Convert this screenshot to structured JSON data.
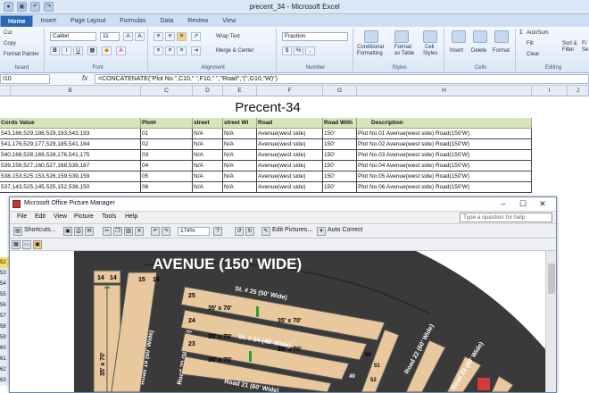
{
  "window": {
    "title": "precent_34 - Microsoft Excel"
  },
  "ribbon_tabs": [
    "Home",
    "Insert",
    "Page Layout",
    "Formulas",
    "Data",
    "Review",
    "View"
  ],
  "ribbon": {
    "clipboard": {
      "cut": "Cut",
      "copy": "Copy",
      "format_painter": "Format Painter",
      "label": "board"
    },
    "font": {
      "name": "Calibri",
      "size": "11",
      "label": "Font",
      "bold": "B",
      "italic": "I",
      "underline": "U"
    },
    "alignment": {
      "wrap": "Wrap Text",
      "merge": "Merge & Center",
      "label": "Alignment"
    },
    "number": {
      "format": "Fraction",
      "label": "Number",
      "currency": "$",
      "percent": "%",
      "comma": ","
    },
    "styles": {
      "cond": "Conditional",
      "cond2": "Formatting",
      "fmt": "Format",
      "fmt2": "as Table",
      "cell": "Cell",
      "cell2": "Styles",
      "label": "Styles"
    },
    "cells": {
      "insert": "Insert",
      "delete": "Delete",
      "format": "Format",
      "label": "Cells"
    },
    "editing": {
      "autosum": "AutoSum",
      "fill": "Fill",
      "clear": "Clear",
      "sort": "Sort &",
      "sort2": "Filter",
      "find": "Fi",
      "find2": "Se",
      "label": "Editing"
    }
  },
  "formula_bar": {
    "name_box": "I10",
    "fx": "fx",
    "formula": "=CONCATENATE(\"Plot No.\",C10,\"  \",F10,\"  \",\"Road\",\"(\",G10,\"W)\")"
  },
  "columns": [
    "B",
    "C",
    "D",
    "E",
    "F",
    "G",
    "H",
    "I",
    "J"
  ],
  "sheet": {
    "heading": "Precent-34",
    "headers": [
      "Cords Value",
      "Plot#",
      "street",
      "street Wi",
      "Road",
      "Road With",
      "Description"
    ],
    "rows": [
      [
        "543,186,529,186,529,193,543,193",
        "01",
        "N/A",
        "N/A",
        "Avenue(west side)",
        "150'",
        "Plot No.01  Avenue(west side)  Road(150'W)"
      ],
      [
        "541,176,529,177,529,185,541,184",
        "02",
        "N/A",
        "N/A",
        "Avenue(west side)",
        "150'",
        "Plot No.02  Avenue(west side)  Road(150'W)"
      ],
      [
        "540,168,528,169,528,176,541,175",
        "03",
        "N/A",
        "N/A",
        "Avenue(west side)",
        "150'",
        "Plot No.03  Avenue(west side)  Road(150'W)"
      ],
      [
        "539,159,527,160,527,168,539,167",
        "04",
        "N/A",
        "N/A",
        "Avenue(west side)",
        "150'",
        "Plot No.04  Avenue(west side)  Road(150'W)"
      ],
      [
        "538,153,525,153,526,159,539,159",
        "05",
        "N/A",
        "N/A",
        "Avenue(west side)",
        "150'",
        "Plot No.05  Avenue(west side)  Road(150'W)"
      ],
      [
        "537,143,525,145,525,152,538,150",
        "06",
        "N/A",
        "N/A",
        "Avenue(west side)",
        "150'",
        "Plot No.06  Avenue(west side)  Road(150'W)"
      ]
    ],
    "row_numbers": [
      "52",
      "53",
      "54",
      "55",
      "56",
      "57",
      "58",
      "59",
      "60",
      "61",
      "62",
      "63"
    ]
  },
  "picture_manager": {
    "title": "Microsoft Office Picture Manager",
    "menu": [
      "File",
      "Edit",
      "View",
      "Picture",
      "Tools",
      "Help"
    ],
    "search_placeholder": "Type a question for help",
    "toolbar": {
      "shortcuts": "Shortcuts...",
      "zoom": "174%",
      "edit": "Edit Pictures...",
      "auto": "Auto Correct"
    },
    "map": {
      "avenue": "AVENUE (150' WIDE)",
      "street25": "St. # 25 (50' Wide)",
      "street24": "St. # 24 (40' Wide)",
      "road21": "Road 21 (60' Wide)",
      "road19": "Road 19 (60' Wide)",
      "road20": "Road 20 (60' Wide)",
      "road22": "Road 22 (60' Wide)",
      "road23": "Road 23 (60' Wide)",
      "dim": "35' x 70'",
      "plots": [
        "14",
        "14",
        "15",
        "16",
        "25",
        "24",
        "23",
        "49",
        "50",
        "51",
        "52"
      ]
    }
  }
}
